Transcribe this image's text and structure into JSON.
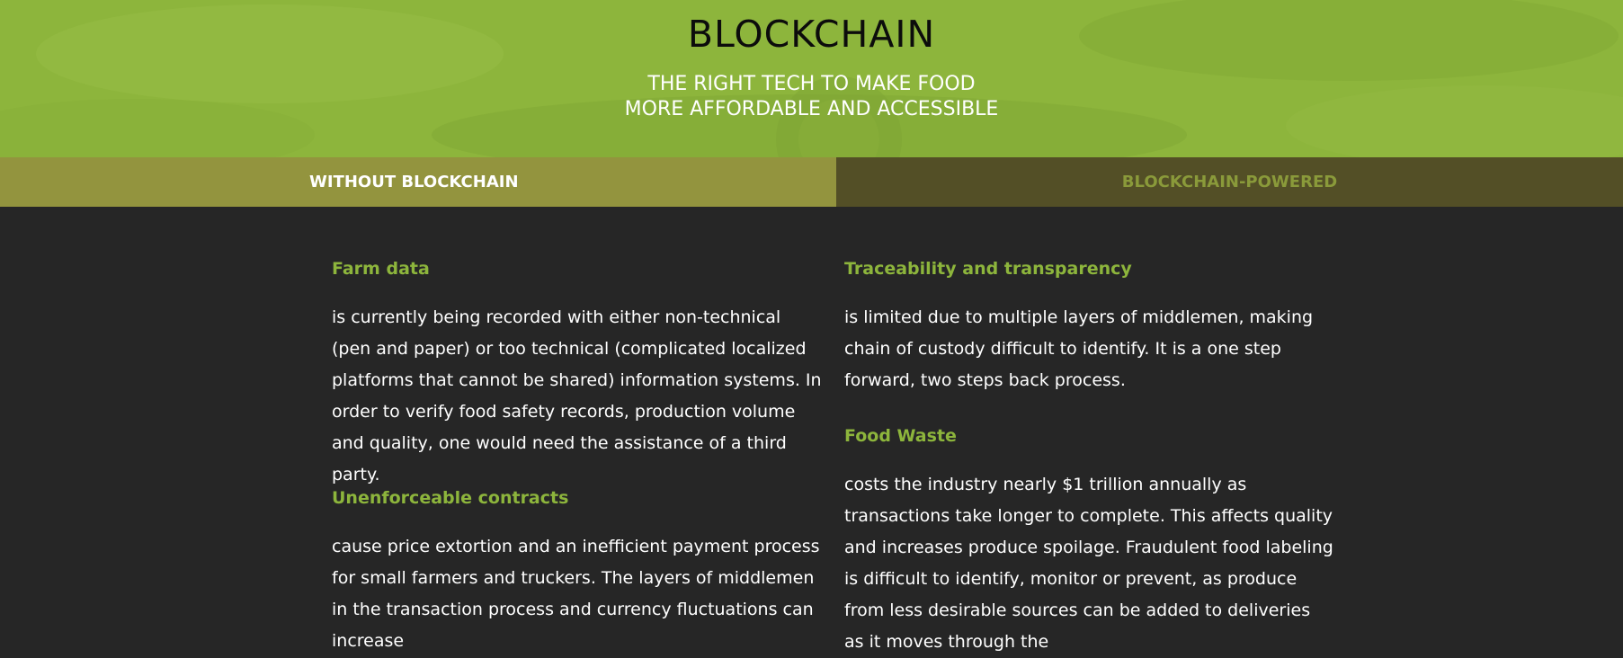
{
  "hero": {
    "title": "BLOCKCHAIN",
    "subtitle_line1": "THE RIGHT TECH TO MAKE FOOD",
    "subtitle_line2": "MORE AFFORDABLE AND ACCESSIBLE"
  },
  "tabs": [
    {
      "label": "WITHOUT BLOCKCHAIN",
      "active": true
    },
    {
      "label": "BLOCKCHAIN-POWERED",
      "active": false
    }
  ],
  "left_column": [
    {
      "title": "Farm data",
      "body": "is currently being recorded with either non-technical (pen and paper) or too technical (complicated localized platforms that cannot be shared) information systems. In order to verify food safety records, production volume and quality, one would need the assistance of a third party."
    },
    {
      "title": "Unenforceable contracts",
      "body": "cause price extortion and an inefficient payment process for small farmers and truckers. The layers of middlemen in the transaction process and currency fluctuations can increase"
    }
  ],
  "right_column": [
    {
      "title": "Traceability and transparency",
      "body": "is limited due to multiple layers of middlemen, making chain of custody difficult to identify. It is a one step forward, two steps back process."
    },
    {
      "title": "Food Waste",
      "body": "costs the industry nearly $1 trillion annually as transactions take longer to complete. This affects quality and increases produce spoilage. Fraudulent food labeling is difficult to identify, monitor or prevent, as produce from less desirable sources can be added to deliveries as it moves through the"
    }
  ],
  "colors": {
    "hero_green": "#8db53c",
    "tab_active": "#93943e",
    "tab_inactive": "#534f26",
    "tab_inactive_text": "#8a9a3a",
    "content_bg": "#262626",
    "accent_title": "#8db53c"
  }
}
